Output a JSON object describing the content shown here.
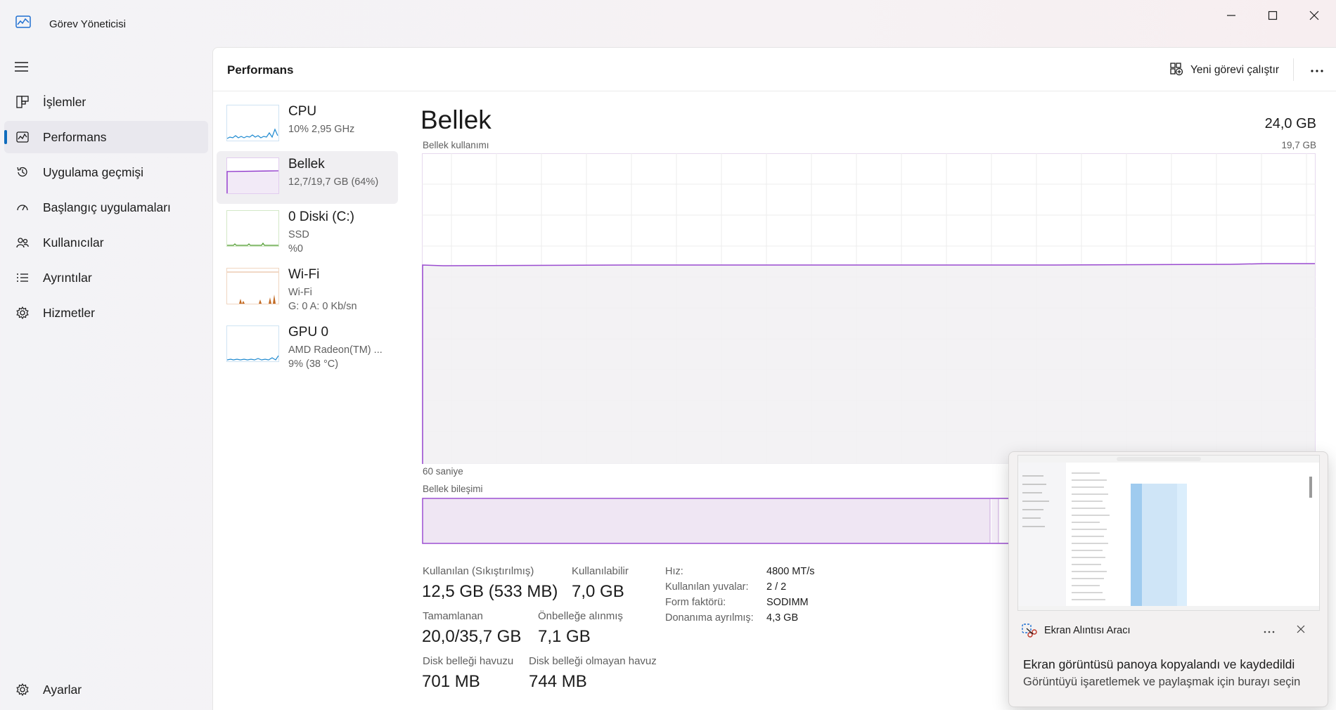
{
  "window": {
    "title": "Görev Yöneticisi",
    "icons": {
      "app": "task-manager-icon",
      "minimize": "minimize-icon",
      "maximize": "maximize-icon",
      "close": "close-icon"
    }
  },
  "sidebar": {
    "items": [
      {
        "label": "İşlemler",
        "icon": "processes-icon",
        "active": false
      },
      {
        "label": "Performans",
        "icon": "performance-icon",
        "active": true
      },
      {
        "label": "Uygulama geçmişi",
        "icon": "history-icon",
        "active": false
      },
      {
        "label": "Başlangıç uygulamaları",
        "icon": "startup-icon",
        "active": false
      },
      {
        "label": "Kullanıcılar",
        "icon": "users-icon",
        "active": false
      },
      {
        "label": "Ayrıntılar",
        "icon": "details-icon",
        "active": false
      },
      {
        "label": "Hizmetler",
        "icon": "services-icon",
        "active": false
      }
    ],
    "settings_label": "Ayarlar"
  },
  "header": {
    "title": "Performans",
    "run_task_label": "Yeni görevi çalıştır"
  },
  "perf_list": [
    {
      "name": "CPU",
      "sub1": "10%  2,95 GHz",
      "color": "#1f8ad0"
    },
    {
      "name": "Bellek",
      "sub1": "12,7/19,7 GB (64%)",
      "color": "#8b2fc9"
    },
    {
      "name": "0 Diski (C:)",
      "sub1": "SSD",
      "sub2": "%0",
      "color": "#4c9a2a"
    },
    {
      "name": "Wi-Fi",
      "sub1": "Wi-Fi",
      "sub2": "G: 0 A: 0 Kb/sn",
      "color": "#c36a23"
    },
    {
      "name": "GPU 0",
      "sub1": "AMD Radeon(TM) ...",
      "sub2": "9% (38 °C)",
      "color": "#1f8ad0"
    }
  ],
  "memory": {
    "title": "Bellek",
    "total": "24,0 GB",
    "usage_label": "Bellek kullanımı",
    "usage_max": "19,7 GB",
    "time_label": "60 saniye",
    "composition_label": "Bellek bileşimi",
    "usage_fraction": 0.64,
    "stats": {
      "in_use_label": "Kullanılan (Sıkıştırılmış)",
      "in_use_value": "12,5 GB (533 MB)",
      "available_label": "Kullanılabilir",
      "available_value": "7,0 GB",
      "committed_label": "Tamamlanan",
      "committed_value": "20,0/35,7 GB",
      "cached_label": "Önbelleğe alınmış",
      "cached_value": "7,1 GB",
      "paged_label": "Disk belleği havuzu",
      "paged_value": "701 MB",
      "nonpaged_label": "Disk belleği olmayan havuz",
      "nonpaged_value": "744 MB"
    },
    "details": [
      {
        "label": "Hız:",
        "value": "4800 MT/s"
      },
      {
        "label": "Kullanılan yuvalar:",
        "value": "2 / 2"
      },
      {
        "label": "Form faktörü:",
        "value": "SODIMM"
      },
      {
        "label": "Donanıma ayrılmış:",
        "value": "4,3 GB"
      }
    ]
  },
  "toast": {
    "app_name": "Ekran Alıntısı Aracı",
    "message": "Ekran görüntüsü panoya kopyalandı ve kaydedildi",
    "subtext": "Görüntüyü işaretlemek ve paylaşmak için burayı seçin"
  }
}
